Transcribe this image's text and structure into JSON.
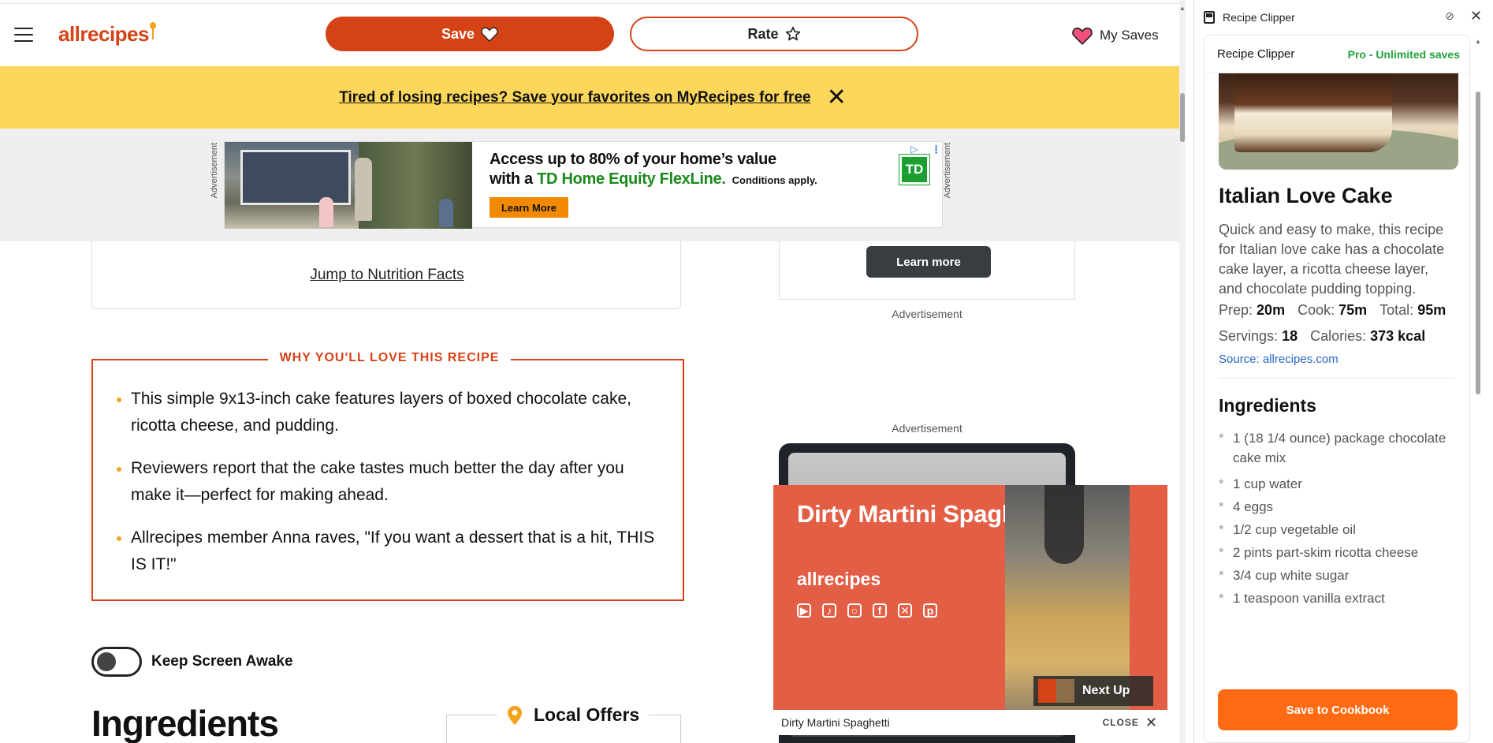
{
  "header": {
    "logo": "allrecipes",
    "save_label": "Save",
    "rate_label": "Rate",
    "my_saves_label": "My Saves"
  },
  "promo": {
    "text": "Tired of losing recipes? Save your favorites on MyRecipes for free"
  },
  "ad_banner": {
    "side_label": "Advertisement",
    "headline_line1": "Access up to 80% of your home’s value",
    "headline_line2_prefix": "with a ",
    "headline_line2_brand": "TD Home Equity FlexLine.",
    "conditions": "Conditions apply.",
    "cta": "Learn More",
    "brand_logo": "TD"
  },
  "main": {
    "nutrition_link": "Jump to Nutrition Facts",
    "why_love_title": "WHY YOU'LL LOVE THIS RECIPE",
    "why_love_items": [
      "This simple 9x13-inch cake features layers of boxed chocolate cake, ricotta cheese, and pudding.",
      "Reviewers report that the cake tastes much better the day after you make it—perfect for making ahead.",
      "Allrecipes member Anna raves, \"If you want a dessert that is a hit, THIS IS IT!\""
    ],
    "keep_screen_awake": "Keep Screen Awake",
    "ingredients_heading": "Ingredients",
    "local_offers": "Local Offers"
  },
  "right_rail": {
    "learn_more": "Learn more",
    "advertisement_1": "Advertisement",
    "advertisement_2": "Advertisement"
  },
  "video": {
    "title": "Dirty Martini Spaghetti",
    "logo": "allrecipes",
    "next_up": "Next Up",
    "bar_title": "Dirty Martini Spaghetti",
    "close_label": "CLOSE"
  },
  "side_panel": {
    "window_title": "Recipe Clipper",
    "card_title": "Recipe Clipper",
    "plan": "Pro - Unlimited saves",
    "recipe_title": "Italian Love Cake",
    "description": "Quick and easy to make, this recipe for Italian love cake has a chocolate cake layer, a ricotta cheese layer, and chocolate pudding topping.",
    "prep_label": "Prep:",
    "prep": "20m",
    "cook_label": "Cook:",
    "cook": "75m",
    "total_label": "Total:",
    "total": "95m",
    "servings_label": "Servings:",
    "servings": "18",
    "calories_label": "Calories:",
    "calories": "373 kcal",
    "source": "Source: allrecipes.com",
    "ingredients_heading": "Ingredients",
    "ingredients": [
      "1 (18 1/4 ounce) package chocolate cake mix",
      "1 cup water",
      "4 eggs",
      "1/2 cup vegetable oil",
      "2 pints part-skim ricotta cheese",
      "3/4 cup white sugar",
      "1 teaspoon vanilla extract"
    ],
    "save_button": "Save to Cookbook"
  },
  "colors": {
    "brand": "#d54215",
    "promo_bg": "#fcd75c",
    "accent_green": "#22a23a",
    "side_button": "#ff6a13",
    "video_bg": "#e25e45"
  }
}
